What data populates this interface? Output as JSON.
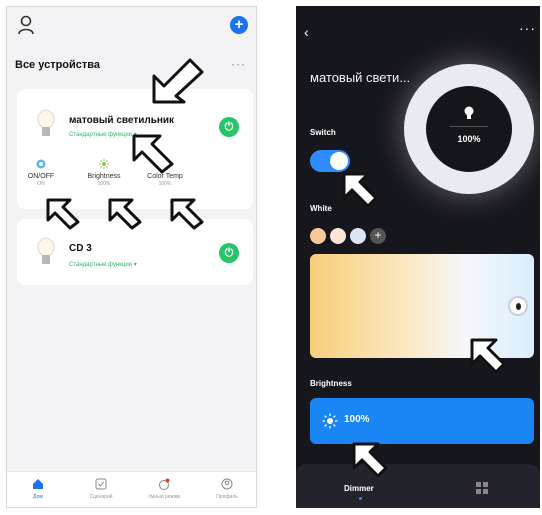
{
  "left_screen": {
    "header": {
      "title": "Все устройства",
      "more": "···"
    },
    "devices": [
      {
        "name": "матовый светильник",
        "subtitle": "Стандартные функции ▾",
        "controls": [
          {
            "label": "ON/OFF",
            "value": "ON"
          },
          {
            "label": "Brightness",
            "value": "100%"
          },
          {
            "label": "Color Temp",
            "value": "100%"
          }
        ]
      },
      {
        "name": "CD 3",
        "subtitle": "Стандартные функции ▾"
      }
    ],
    "tabs": [
      {
        "label": "Дом",
        "icon": "home-icon",
        "active": true
      },
      {
        "label": "Сценарий",
        "icon": "checklist-icon"
      },
      {
        "label": "Умный режим",
        "icon": "smart-mode-icon"
      },
      {
        "label": "Профиль",
        "icon": "profile-icon"
      }
    ]
  },
  "right_screen": {
    "title": "матовый свети...",
    "more": "···",
    "ring_value": "100%",
    "switch_label": "Switch",
    "switch_on": true,
    "white_label": "White",
    "swatches": [
      "#f7c99a",
      "#fbe5d6",
      "#dfe4f5"
    ],
    "brightness_label": "Brightness",
    "brightness_value": "100%",
    "bottom_tab": "Dimmer"
  },
  "colors": {
    "accent_blue": "#1a73f0",
    "power_green": "#27c46a",
    "dark_bg": "#16171d",
    "brightness_blue": "#1a85f5"
  }
}
